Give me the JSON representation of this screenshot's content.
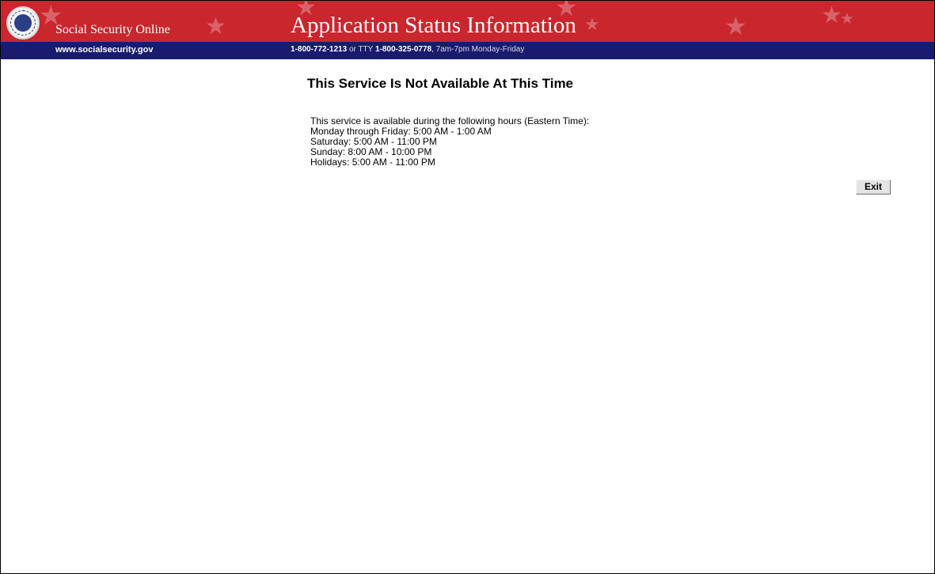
{
  "header": {
    "site_name": "Social Security Online",
    "app_title": "Application Status Information",
    "site_url": "www.socialsecurity.gov",
    "phone": "1-800-772-1213",
    "phone_or": " or TTY ",
    "tty": "1-800-325-0778",
    "hours_text": ", 7am-7pm Monday-Friday",
    "colors": {
      "top_band": "#c9262e",
      "bottom_band": "#1a1a6e"
    }
  },
  "main": {
    "title": "This Service Is Not Available At This Time",
    "intro": "This service is available during the following hours (Eastern Time):",
    "hours": [
      "Monday through Friday: 5:00 AM - 1:00 AM",
      "Saturday: 5:00 AM - 11:00 PM",
      "Sunday: 8:00 AM - 10:00 PM",
      "Holidays: 5:00 AM - 11:00 PM"
    ],
    "exit_label": "Exit"
  }
}
